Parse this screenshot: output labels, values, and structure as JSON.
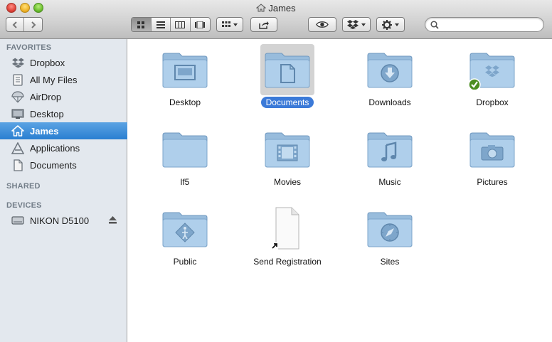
{
  "window": {
    "title": "James"
  },
  "toolbar": {
    "back_icon": "chevron-left-icon",
    "forward_icon": "chevron-right-icon",
    "view_modes": [
      "icon-view",
      "list-view",
      "column-view",
      "cover-flow-view"
    ],
    "active_view": "icon-view",
    "search": {
      "value": "",
      "placeholder": ""
    }
  },
  "sidebar": {
    "favorites_heading": "FAVORITES",
    "favorites": [
      {
        "label": "Dropbox",
        "icon": "dropbox-icon"
      },
      {
        "label": "All My Files",
        "icon": "all-files-icon"
      },
      {
        "label": "AirDrop",
        "icon": "airdrop-icon"
      },
      {
        "label": "Desktop",
        "icon": "desktop-icon"
      },
      {
        "label": "James",
        "icon": "home-icon",
        "selected": true
      },
      {
        "label": "Applications",
        "icon": "applications-icon"
      },
      {
        "label": "Documents",
        "icon": "documents-icon"
      }
    ],
    "shared_heading": "SHARED",
    "devices_heading": "DEVICES",
    "devices": [
      {
        "label": "NIKON D5100",
        "icon": "drive-icon"
      }
    ]
  },
  "content": {
    "items": [
      {
        "name": "Desktop",
        "glyph": "desktop"
      },
      {
        "name": "Documents",
        "glyph": "document",
        "selected": true
      },
      {
        "name": "Downloads",
        "glyph": "downloads"
      },
      {
        "name": "Dropbox",
        "glyph": "dropbox",
        "synced": true
      },
      {
        "name": "lf5",
        "glyph": "none"
      },
      {
        "name": "Movies",
        "glyph": "movies"
      },
      {
        "name": "Music",
        "glyph": "music"
      },
      {
        "name": "Pictures",
        "glyph": "pictures"
      },
      {
        "name": "Public",
        "glyph": "public"
      },
      {
        "name": "Send Registration",
        "glyph": "alias-file"
      },
      {
        "name": "Sites",
        "glyph": "sites"
      }
    ]
  },
  "colors": {
    "selection_blue": "#3b7ad8",
    "sidebar_bg": "#e3e8ee",
    "folder_blue": "#a9c8e2"
  }
}
